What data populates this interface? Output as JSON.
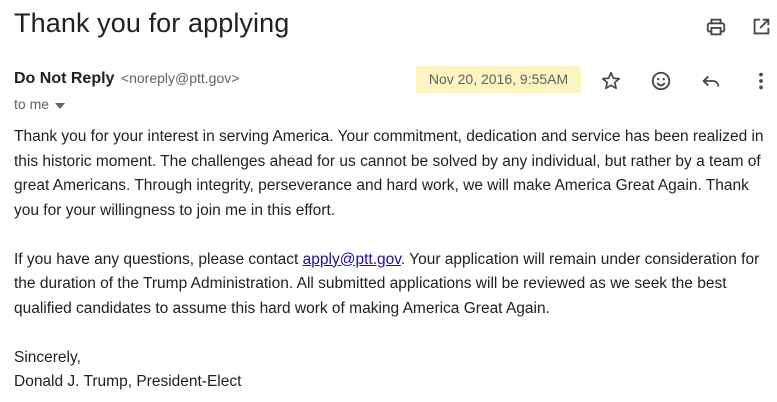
{
  "email": {
    "subject": "Thank you for applying",
    "sender_name": "Do Not Reply",
    "sender_email": "<noreply@ptt.gov>",
    "recipient_label": "to me",
    "date": "Nov 20, 2016, 9:55AM",
    "highlight_color": "#fcf5bf",
    "link_color": "#1a0dab",
    "icons": [
      "print-icon",
      "open-in-new-window-icon",
      "star-icon",
      "emoji-reaction-icon",
      "reply-icon",
      "more-options-icon",
      "chevron-down-icon"
    ],
    "body": {
      "p1": "Thank you for your interest in serving America. Your commitment, dedication and service has been realized in this historic moment. The challenges ahead for us cannot be solved by any individual, but rather by a team of great Americans. Through integrity, perseverance and hard work, we will make America Great Again. Thank you for your willingness to join me in this effort.",
      "p2_before": "If you have any questions, please contact ",
      "p2_link": "apply@ptt.gov",
      "p2_after": ". Your application will remain under consideration for the duration of the Trump Administration. All submitted applications will be reviewed as we seek the best qualified candidates to assume this hard work of making America Great Again.",
      "closing": "Sincerely,",
      "signature": "Donald J. Trump, President-Elect"
    }
  }
}
